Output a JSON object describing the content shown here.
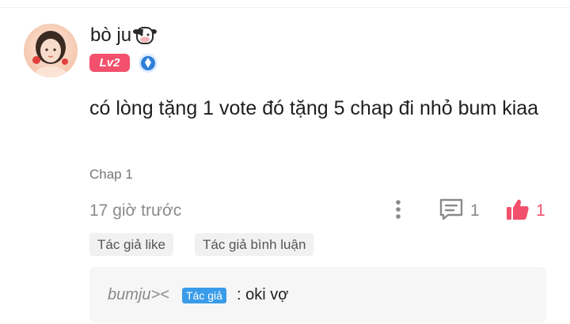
{
  "comment": {
    "username": "bò ju",
    "level": "Lv2",
    "text": "có lòng tặng 1 vote đó tặng 5 chap đi nhỏ bum kiaa",
    "chapter": "Chap 1",
    "time": "17 giờ trước",
    "reply_count": "1",
    "like_count": "1"
  },
  "tags": {
    "author_like": "Tác giả like",
    "author_reply": "Tác giả bình luận"
  },
  "reply": {
    "author": "bumju><",
    "badge": "Tác giả",
    "separator": ":",
    "text": "oki vợ"
  },
  "icons": {
    "user_suffix": "cow-icon",
    "verify": "verified-badge-icon",
    "more": "more-vertical-icon",
    "reply": "comment-icon",
    "like": "thumbs-up-icon"
  },
  "colors": {
    "accent": "#f2506d",
    "author_badge": "#3a9ce9",
    "verify": "#2f7fd9",
    "text": "#1f1f1f",
    "muted": "#8a8a8a"
  }
}
